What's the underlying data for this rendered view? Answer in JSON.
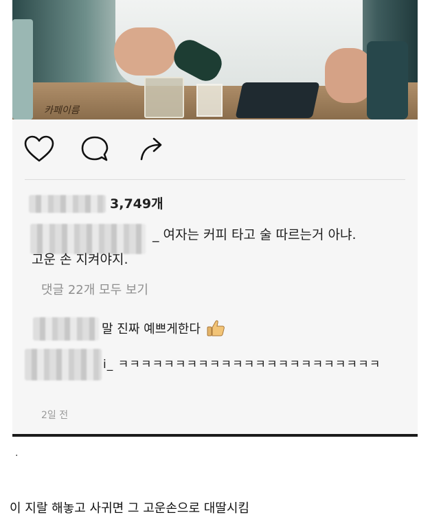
{
  "post": {
    "photo_wordmark": "카페이름",
    "actions": {
      "like_icon": "heart-icon",
      "comment_icon": "comment-bubble-icon",
      "share_icon": "share-arrow-icon"
    },
    "likes_text": "3,749개",
    "caption_line1": "_ 여자는 커피 타고 술 따르는거 아냐.",
    "caption_line2": "고운 손 지켜야지.",
    "view_all_comments": "댓글 22개 모두 보기",
    "comments": [
      {
        "text": "말 진짜 예쁘게한다",
        "emoji": "thumbs-up-icon"
      },
      {
        "text": "i_ ㅋㅋㅋㅋㅋㅋㅋㅋㅋㅋㅋㅋㅋㅋㅋㅋㅋㅋㅋㅋㅋㅋㅋ"
      }
    ],
    "timestamp": "2일 전"
  },
  "footer": {
    "dot": ".",
    "caption": "이 지랄 해놓고 사귀면 그 고운손으로 대딸시킴"
  }
}
